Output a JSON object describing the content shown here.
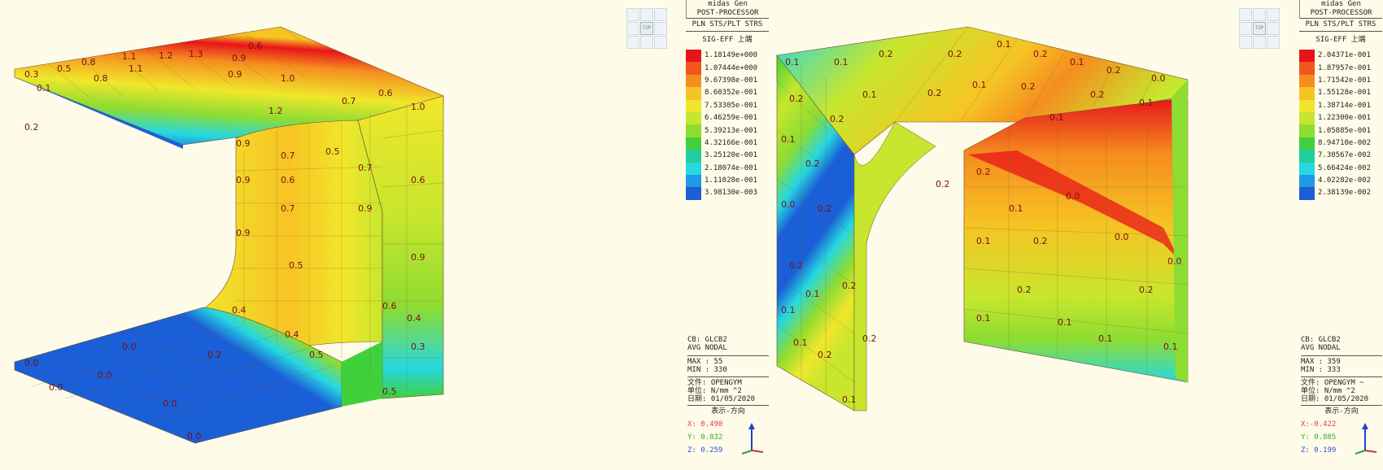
{
  "panels": [
    {
      "program": "midas Gen",
      "module": "POST-PROCESSOR",
      "result_type": "PLN STS/PLT STRS",
      "component": "SIG-EFF 上端",
      "legend": [
        "1.18149e+000",
        "1.07444e+000",
        "9.67398e-001",
        "8.60352e-001",
        "7.53305e-001",
        "6.46259e-001",
        "5.39213e-001",
        "4.32166e-001",
        "3.25120e-001",
        "2.18074e-001",
        "1.11028e-001",
        "3.98130e-003"
      ],
      "load_case": "CB: GLCB2",
      "averaging": "AVG NODAL",
      "max": "MAX : 55",
      "min": "MIN : 330",
      "file": "文件: OPENGYM",
      "unit": "单位: N/mm ^2",
      "date": "日期: 01/05/2020",
      "view_dir": "表示-方向",
      "x": "X: 0.490",
      "y": "Y: 0.832",
      "z": "Z: 0.259"
    },
    {
      "program": "midas Gen",
      "module": "POST-PROCESSOR",
      "result_type": "PLN STS/PLT STRS",
      "component": "SIG-EFF 上端",
      "legend": [
        "2.04371e-001",
        "1.87957e-001",
        "1.71542e-001",
        "1.55128e-001",
        "1.38714e-001",
        "1.22300e-001",
        "1.05885e-001",
        "8.94710e-002",
        "7.30567e-002",
        "5.66424e-002",
        "4.02282e-002",
        "2.38139e-002"
      ],
      "load_case": "CB: GLCB2",
      "averaging": "AVG NODAL",
      "max": "MAX : 359",
      "min": "MIN : 333",
      "file": "文件: OPENGYM ~",
      "unit": "单位: N/mm ^2",
      "date": "日期: 01/05/2020",
      "view_dir": "表示-方向",
      "x": "X:-0.422",
      "y": "Y: 0.885",
      "z": "Z: 0.199"
    }
  ],
  "legend_colors": [
    "#e8141a",
    "#f2561c",
    "#f58d1f",
    "#f6c424",
    "#f0e72b",
    "#c7e62d",
    "#8ddc32",
    "#3fd03b",
    "#22cf9c",
    "#26d8e0",
    "#1e9ae6",
    "#1a5fd8"
  ],
  "nav_label": "TOP",
  "contour_values_left": [
    "1.1",
    "1.2",
    "1.3",
    "1.1",
    "0.9",
    "0.8",
    "0.6",
    "0.5",
    "0.3",
    "0.1",
    "1.0",
    "0.9",
    "0.8",
    "0.7",
    "0.6",
    "1.2",
    "0.9",
    "0.7",
    "0.9",
    "0.6",
    "0.5",
    "0.7",
    "0.9",
    "0.6",
    "0.5",
    "0.4",
    "0.2",
    "0.0",
    "0.0",
    "0.0",
    "0.0",
    "0.2",
    "0.4",
    "0.5",
    "0.7",
    "0.9",
    "1.0",
    "0.6",
    "0.9",
    "0.4",
    "0.3",
    "0.5",
    "0.0",
    "0.0"
  ],
  "contour_values_right": [
    "0.1",
    "0.1",
    "0.2",
    "0.2",
    "0.1",
    "0.2",
    "0.1",
    "0.2",
    "0.0",
    "0.0",
    "0.2",
    "0.2",
    "0.1",
    "0.2",
    "0.1",
    "0.2",
    "0.1",
    "0.2",
    "0.1",
    "0.1",
    "0.2",
    "0.0",
    "0.2",
    "0.2",
    "0.1",
    "0.2",
    "0.1",
    "0.1",
    "0.2",
    "0.2",
    "0.1",
    "0.1",
    "0.2",
    "0.0",
    "0.0",
    "0.1",
    "0.2",
    "0.1",
    "0.1",
    "0.2",
    "0.1",
    "0.2",
    "0.2",
    "0.1"
  ]
}
